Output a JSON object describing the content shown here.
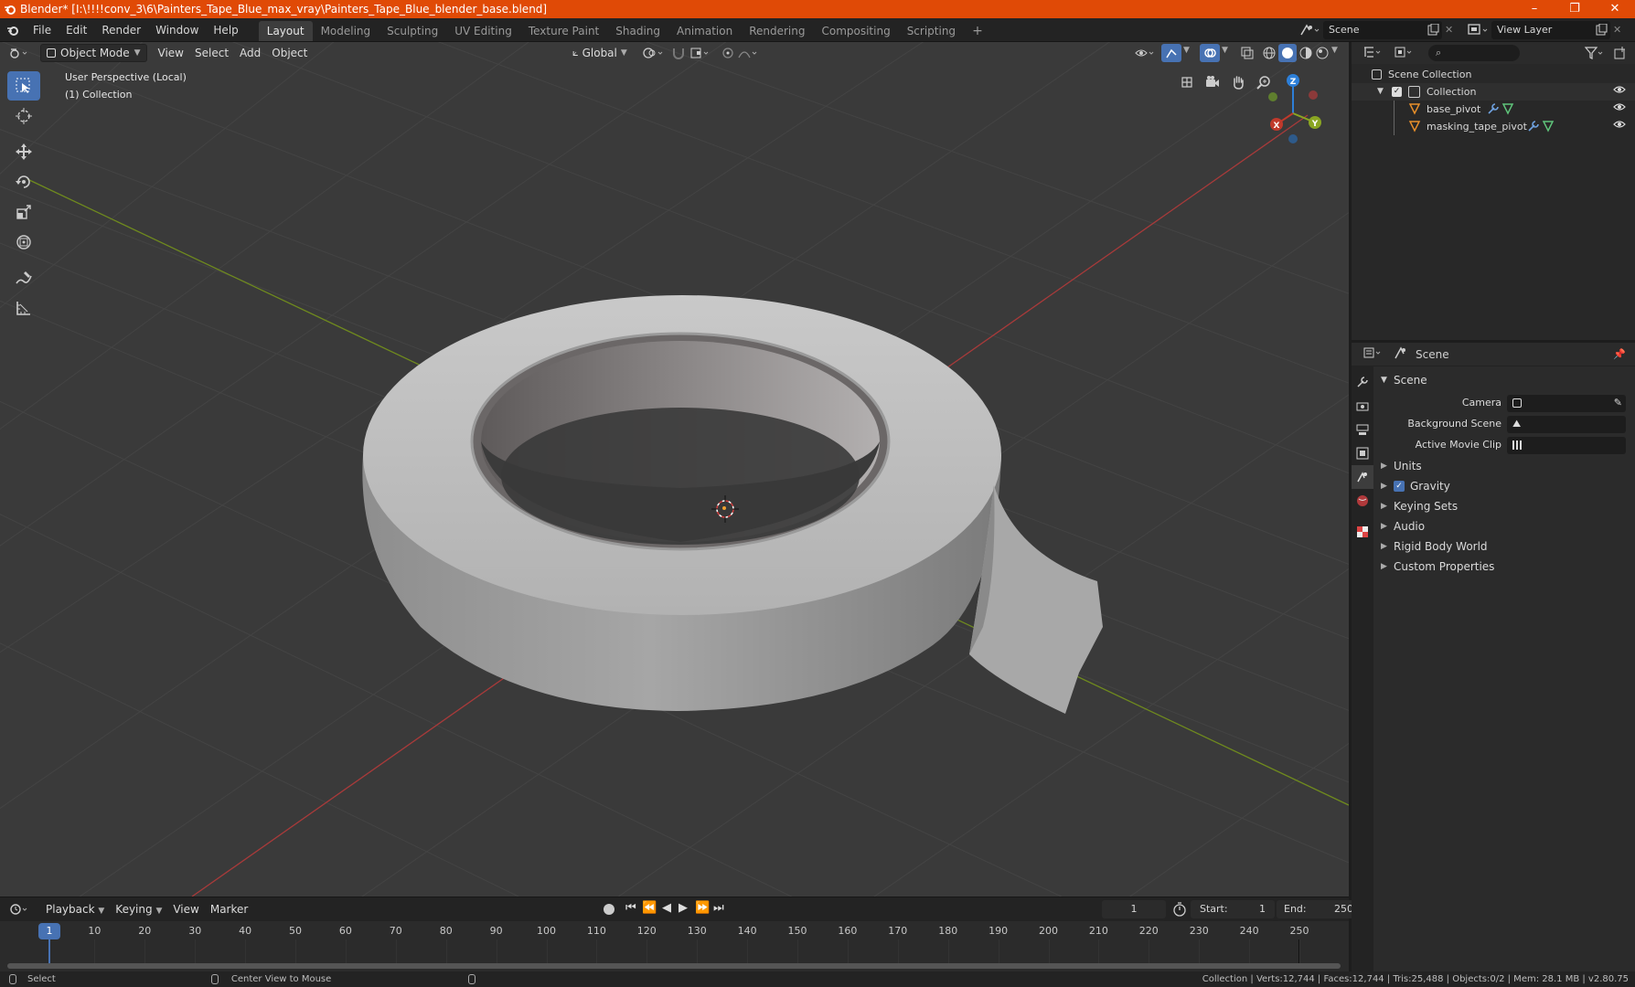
{
  "window": {
    "title": "Blender* [I:\\!!!!conv_3\\6\\Painters_Tape_Blue_max_vray\\Painters_Tape_Blue_blender_base.blend]",
    "minimize": "–",
    "maximize": "❐",
    "close": "✕"
  },
  "menu": [
    "File",
    "Edit",
    "Render",
    "Window",
    "Help"
  ],
  "workspaces": [
    "Layout",
    "Modeling",
    "Sculpting",
    "UV Editing",
    "Texture Paint",
    "Shading",
    "Animation",
    "Rendering",
    "Compositing",
    "Scripting"
  ],
  "workspace_add": "+",
  "scene_name": "Scene",
  "view_layer": "View Layer",
  "viewport": {
    "mode": "Object Mode",
    "menus": [
      "View",
      "Select",
      "Add",
      "Object"
    ],
    "orientation": "Global",
    "perspective_label": "User Perspective (Local)",
    "collection_label": "(1) Collection",
    "gizmo": {
      "x": "X",
      "y": "Y",
      "z": "Z"
    }
  },
  "timeline": {
    "menus": [
      "Playback",
      "Keying",
      "View",
      "Marker"
    ],
    "current_frame": "1",
    "start_label": "Start:",
    "start": "1",
    "end_label": "End:",
    "end": "250",
    "frame_marks": [
      "1",
      "10",
      "20",
      "30",
      "40",
      "50",
      "60",
      "70",
      "80",
      "90",
      "100",
      "110",
      "120",
      "130",
      "140",
      "150",
      "160",
      "170",
      "180",
      "190",
      "200",
      "210",
      "220",
      "230",
      "240",
      "250"
    ]
  },
  "statusbar": {
    "select": "Select",
    "center_view": "Center View to Mouse",
    "stats": "Collection | Verts:12,744 | Faces:12,744 | Tris:25,488 | Objects:0/2 | Mem: 28.1 MB | v2.80.75"
  },
  "outliner": {
    "root": "Scene Collection",
    "collection": "Collection",
    "objects": [
      "base_pivot",
      "masking_tape_pivot"
    ]
  },
  "properties": {
    "header": "Scene",
    "panel_title": "Scene",
    "camera_label": "Camera",
    "background_scene_label": "Background Scene",
    "active_movie_clip_label": "Active Movie Clip",
    "sections": [
      "Units",
      "Gravity",
      "Keying Sets",
      "Audio",
      "Rigid Body World",
      "Custom Properties"
    ],
    "gravity_enabled": true
  },
  "colors": {
    "accent": "#4772b3",
    "titlebar": "#e04a06",
    "x_axis": "#c0392b",
    "y_axis": "#8aa522",
    "z_axis": "#2d7fd8"
  }
}
